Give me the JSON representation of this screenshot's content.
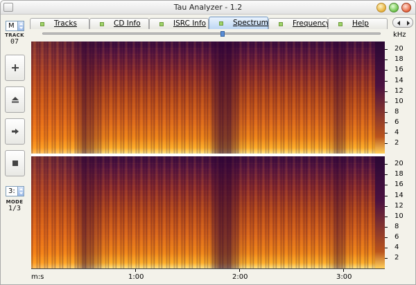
{
  "window": {
    "title": "Tau Analyzer - 1.2"
  },
  "sidebar": {
    "mode_select_value": "M",
    "track_label": "TRACK",
    "track_value": "07",
    "mode_label": "MODE",
    "mode_select2_value": "3:",
    "mode_value": "1/3",
    "buttons": [
      {
        "icon": "plus-icon"
      },
      {
        "icon": "eject-icon"
      },
      {
        "icon": "play-arrow-icon"
      },
      {
        "icon": "stop-icon"
      }
    ]
  },
  "tabs": [
    {
      "label": "Tracks",
      "active": false
    },
    {
      "label": "CD Info",
      "active": false
    },
    {
      "label": "ISRC Info",
      "active": false
    },
    {
      "label": "Spectrum",
      "active": true
    },
    {
      "label": "Frequency",
      "active": false
    },
    {
      "label": "Help",
      "active": false
    }
  ],
  "spectrum": {
    "unit_label": "kHz",
    "freq_labels": [
      "20",
      "18",
      "16",
      "14",
      "12",
      "10",
      "8",
      "6",
      "4",
      "2"
    ],
    "time_axis_label": "m:s",
    "time_labels": [
      "1:00",
      "2:00",
      "3:00"
    ],
    "colormap": [
      "#3a0c3e",
      "#8a2a2c",
      "#d9641a",
      "#ffb02a",
      "#ffe88a"
    ]
  }
}
